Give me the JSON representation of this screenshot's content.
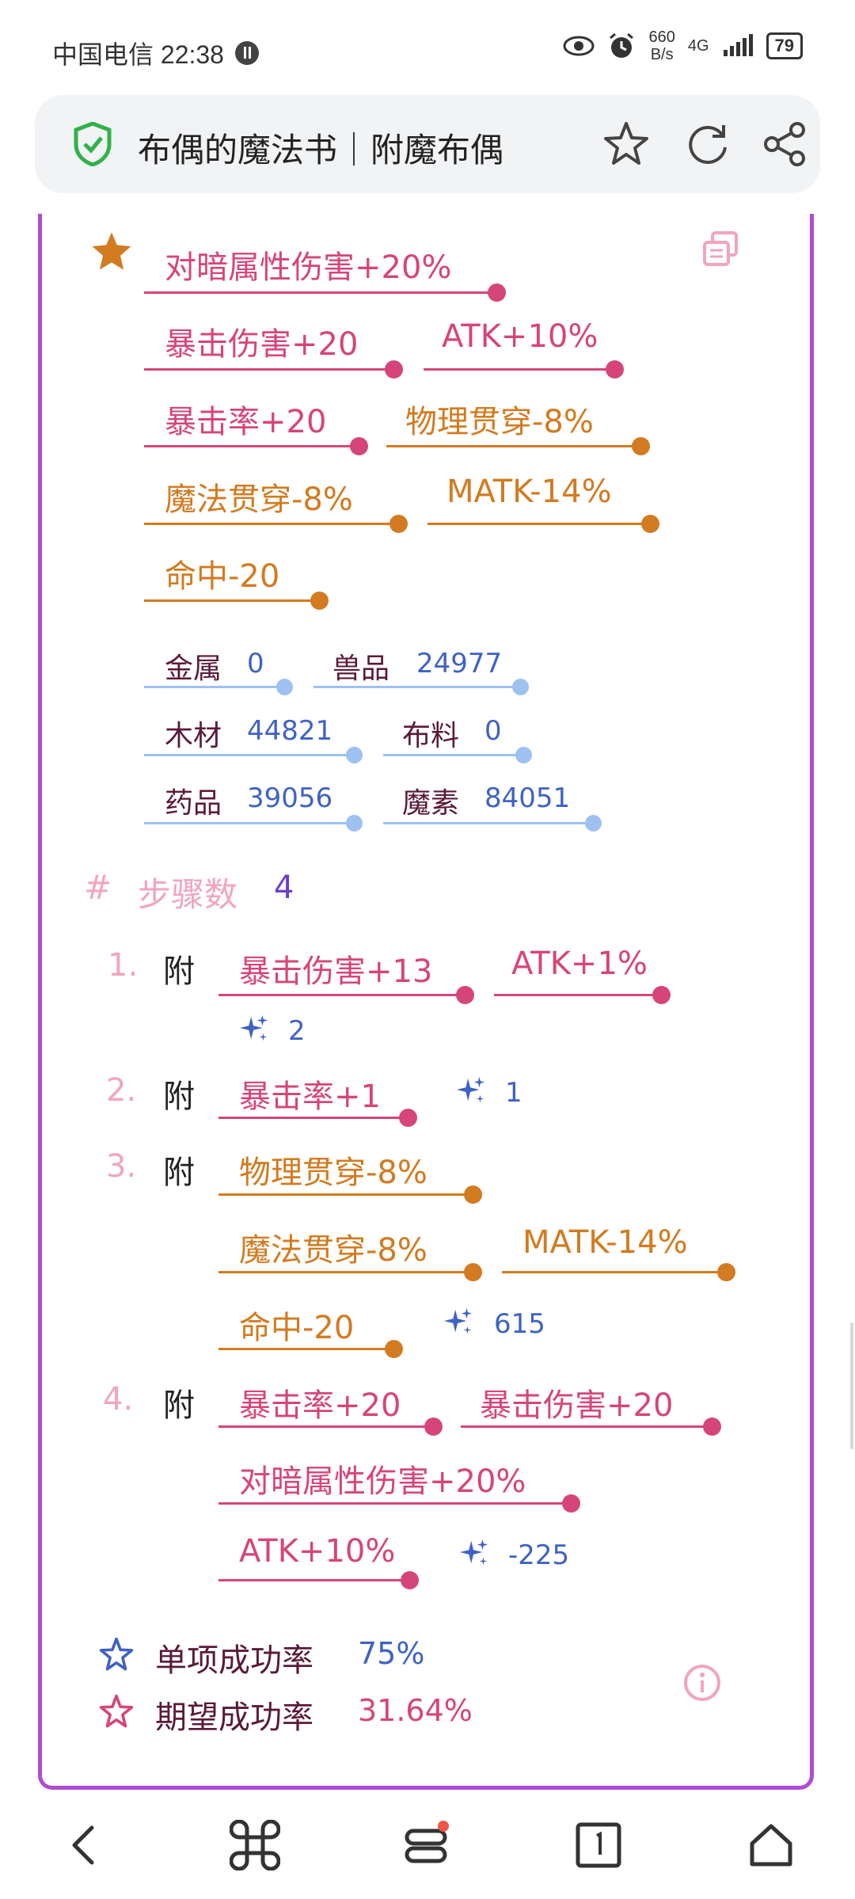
{
  "status_bar": {
    "carrier_time": "中国电信 22:38",
    "net_speed_value": "660",
    "net_speed_unit": "B/s",
    "signal": "4G",
    "battery": "79"
  },
  "browser": {
    "page_title": "布偶的魔法书｜附魔布偶"
  },
  "result": {
    "attributes": [
      {
        "label": "对暗属性伤害+20%",
        "color": "pink"
      },
      {
        "label": "暴击伤害+20",
        "color": "pink"
      },
      {
        "label": "ATK+10%",
        "color": "pink"
      },
      {
        "label": "暴击率+20",
        "color": "pink"
      },
      {
        "label": "物理贯穿-8%",
        "color": "orange"
      },
      {
        "label": "魔法贯穿-8%",
        "color": "orange"
      },
      {
        "label": "MATK-14%",
        "color": "orange"
      },
      {
        "label": "命中-20",
        "color": "orange"
      }
    ],
    "materials": [
      {
        "label": "金属",
        "value": "0"
      },
      {
        "label": "兽品",
        "value": "24977"
      },
      {
        "label": "木材",
        "value": "44821"
      },
      {
        "label": "布料",
        "value": "0"
      },
      {
        "label": "药品",
        "value": "39056"
      },
      {
        "label": "魔素",
        "value": "84051"
      }
    ]
  },
  "steps": {
    "hash": "#",
    "label": "步骤数",
    "count": "4",
    "items": [
      {
        "num": "1.",
        "action": "附",
        "tags": [
          "暴击伤害+13",
          "ATK+1%"
        ],
        "cost": "2"
      },
      {
        "num": "2.",
        "action": "附",
        "tags": [
          "暴击率+1"
        ],
        "cost": "1"
      },
      {
        "num": "3.",
        "action": "附",
        "tags": [
          "物理贯穿-8%",
          "魔法贯穿-8%",
          "MATK-14%",
          "命中-20"
        ],
        "cost": "615"
      },
      {
        "num": "4.",
        "action": "附",
        "tags": [
          "暴击率+20",
          "暴击伤害+20",
          "对暗属性伤害+20%",
          "ATK+10%"
        ],
        "cost": "-225"
      }
    ]
  },
  "rates": {
    "single_label": "单项成功率",
    "single_value": "75%",
    "expected_label": "期望成功率",
    "expected_value": "31.64%"
  },
  "colors": {
    "pink": "#d6457a",
    "orange": "#d27b20",
    "blue": "#3f62c4",
    "card_border": "#b04bd1"
  },
  "icons": {
    "star": "star-icon",
    "copy": "copy-icon",
    "spark": "sparkle-icon",
    "info": "info-icon"
  }
}
